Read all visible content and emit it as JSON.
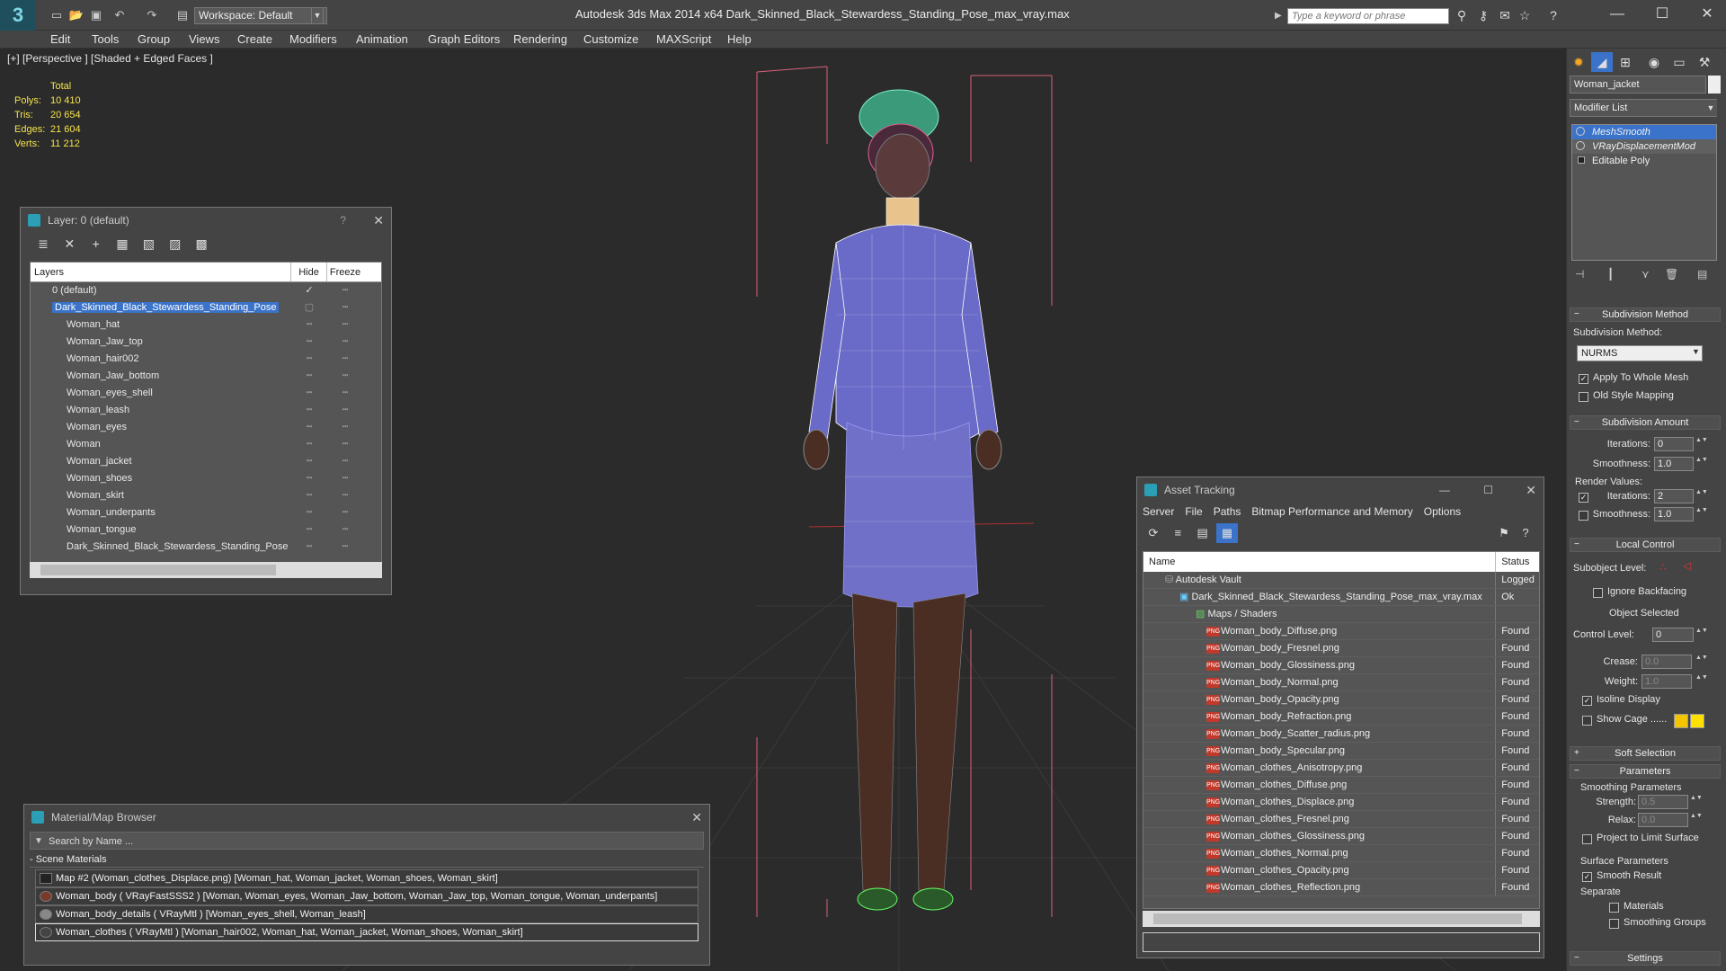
{
  "window": {
    "title": "Autodesk 3ds Max  2014 x64      Dark_Skinned_Black_Stewardess_Standing_Pose_max_vray.max",
    "workspace": "Workspace: Default",
    "search_placeholder": "Type a keyword or phrase"
  },
  "menu": [
    "Edit",
    "Tools",
    "Group",
    "Views",
    "Create",
    "Modifiers",
    "Animation",
    "Graph Editors",
    "Rendering",
    "Customize",
    "MAXScript",
    "Help"
  ],
  "viewport": {
    "label": "[+] [Perspective ] [Shaded + Edged Faces ]",
    "stats": {
      "header": "Total",
      "rows": [
        {
          "k": "Polys:",
          "v": "10 410"
        },
        {
          "k": "Tris:",
          "v": "20 654"
        },
        {
          "k": "Edges:",
          "v": "21 604"
        },
        {
          "k": "Verts:",
          "v": "11 212"
        }
      ]
    }
  },
  "layer_panel": {
    "title": "Layer: 0 (default)",
    "help": "?",
    "columns": {
      "layers": "Layers",
      "hide": "Hide",
      "freeze": "Freeze"
    },
    "rows": [
      {
        "name": "0 (default)"
      },
      {
        "name": "Dark_Skinned_Black_Stewardess_Standing_Pose"
      },
      {
        "name": "Woman_hat"
      },
      {
        "name": "Woman_Jaw_top"
      },
      {
        "name": "Woman_hair002"
      },
      {
        "name": "Woman_Jaw_bottom"
      },
      {
        "name": "Woman_eyes_shell"
      },
      {
        "name": "Woman_leash"
      },
      {
        "name": "Woman_eyes"
      },
      {
        "name": "Woman"
      },
      {
        "name": "Woman_jacket"
      },
      {
        "name": "Woman_shoes"
      },
      {
        "name": "Woman_skirt"
      },
      {
        "name": "Woman_underpants"
      },
      {
        "name": "Woman_tongue"
      },
      {
        "name": "Dark_Skinned_Black_Stewardess_Standing_Pose"
      }
    ]
  },
  "material_browser": {
    "title": "Material/Map Browser",
    "search": "Search by Name ...",
    "section": "- Scene Materials",
    "items": [
      "Map #2 (Woman_clothes_Displace.png) [Woman_hat, Woman_jacket, Woman_shoes, Woman_skirt]",
      "Woman_body  ( VRayFastSSS2 ) [Woman, Woman_eyes, Woman_Jaw_bottom, Woman_Jaw_top, Woman_tongue, Woman_underpants]",
      "Woman_body_details  ( VRayMtl ) [Woman_eyes_shell, Woman_leash]",
      "Woman_clothes  ( VRayMtl ) [Woman_hair002, Woman_hat, Woman_jacket, Woman_shoes, Woman_skirt]"
    ]
  },
  "asset_tracking": {
    "title": "Asset Tracking",
    "menu": [
      "Server",
      "File",
      "Paths",
      "Bitmap Performance and Memory",
      "Options"
    ],
    "columns": {
      "name": "Name",
      "status": "Status"
    },
    "rows": [
      {
        "name": "Autodesk Vault",
        "status": "Logged",
        "indent": 1
      },
      {
        "name": "Dark_Skinned_Black_Stewardess_Standing_Pose_max_vray.max",
        "status": "Ok",
        "indent": 2
      },
      {
        "name": "Maps / Shaders",
        "status": "",
        "indent": 3
      },
      {
        "name": "Woman_body_Diffuse.png",
        "status": "Found",
        "indent": 4
      },
      {
        "name": "Woman_body_Fresnel.png",
        "status": "Found",
        "indent": 4
      },
      {
        "name": "Woman_body_Glossiness.png",
        "status": "Found",
        "indent": 4
      },
      {
        "name": "Woman_body_Normal.png",
        "status": "Found",
        "indent": 4
      },
      {
        "name": "Woman_body_Opacity.png",
        "status": "Found",
        "indent": 4
      },
      {
        "name": "Woman_body_Refraction.png",
        "status": "Found",
        "indent": 4
      },
      {
        "name": "Woman_body_Scatter_radius.png",
        "status": "Found",
        "indent": 4
      },
      {
        "name": "Woman_body_Specular.png",
        "status": "Found",
        "indent": 4
      },
      {
        "name": "Woman_clothes_Anisotropy.png",
        "status": "Found",
        "indent": 4
      },
      {
        "name": "Woman_clothes_Diffuse.png",
        "status": "Found",
        "indent": 4
      },
      {
        "name": "Woman_clothes_Displace.png",
        "status": "Found",
        "indent": 4
      },
      {
        "name": "Woman_clothes_Fresnel.png",
        "status": "Found",
        "indent": 4
      },
      {
        "name": "Woman_clothes_Glossiness.png",
        "status": "Found",
        "indent": 4
      },
      {
        "name": "Woman_clothes_Normal.png",
        "status": "Found",
        "indent": 4
      },
      {
        "name": "Woman_clothes_Opacity.png",
        "status": "Found",
        "indent": 4
      },
      {
        "name": "Woman_clothes_Reflection.png",
        "status": "Found",
        "indent": 4
      }
    ]
  },
  "command_panel": {
    "object_name": "Woman_jacket",
    "modifier_list": "Modifier List",
    "stack": [
      "MeshSmooth",
      "VRayDisplacementMod",
      "Editable Poly"
    ],
    "subdivision_method_title": "Subdivision Method",
    "subdivision_method_label": "Subdivision Method:",
    "subdivision_method_value": "NURMS",
    "apply_whole_mesh": "Apply To Whole Mesh",
    "old_style_mapping": "Old Style Mapping",
    "subdivision_amount_title": "Subdivision Amount",
    "iterations_label": "Iterations:",
    "iterations_value": "0",
    "smoothness_label": "Smoothness:",
    "smoothness_value": "1.0",
    "render_values": "Render Values:",
    "render_iterations_label": "Iterations:",
    "render_iterations_value": "2",
    "render_smoothness_label": "Smoothness:",
    "render_smoothness_value": "1.0",
    "local_control_title": "Local Control",
    "subobject_level": "Subobject Level:",
    "ignore_backfacing": "Ignore Backfacing",
    "object_selected": "Object Selected",
    "control_level_label": "Control Level:",
    "control_level_value": "0",
    "crease_label": "Crease:",
    "crease_value": "0.0",
    "weight_label": "Weight:",
    "weight_value": "1.0",
    "isoline_display": "Isoline Display",
    "show_cage": "Show Cage ......",
    "soft_selection_title": "Soft Selection",
    "parameters_title": "Parameters",
    "smoothing_params": "Smoothing Parameters",
    "strength_label": "Strength:",
    "strength_value": "0.5",
    "relax_label": "Relax:",
    "relax_value": "0.0",
    "project_limit": "Project to Limit Surface",
    "surface_params": "Surface Parameters",
    "smooth_result": "Smooth Result",
    "separate": "Separate",
    "materials": "Materials",
    "smoothing_groups": "Smoothing Groups",
    "settings_title": "Settings"
  }
}
